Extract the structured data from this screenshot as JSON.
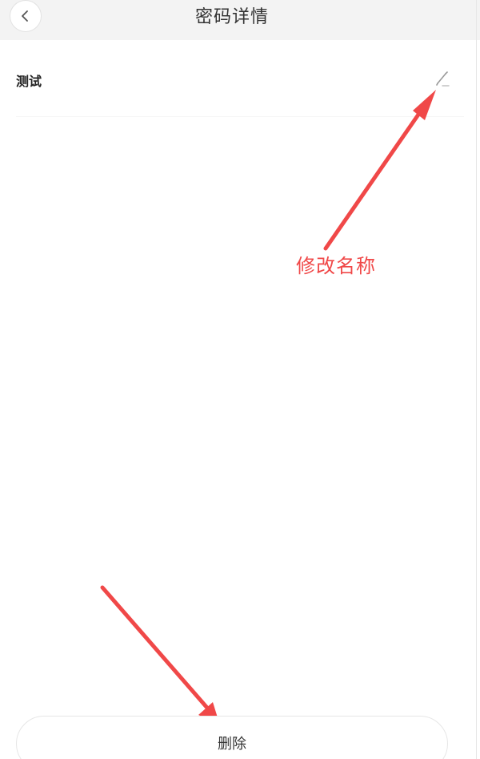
{
  "header": {
    "title": "密码详情"
  },
  "entry": {
    "name": "测试"
  },
  "annotation": {
    "label": "修改名称",
    "color": "#f04848"
  },
  "footer": {
    "delete_label": "删除"
  },
  "icons": {
    "back": "chevron-left-icon",
    "edit": "pencil-icon"
  }
}
